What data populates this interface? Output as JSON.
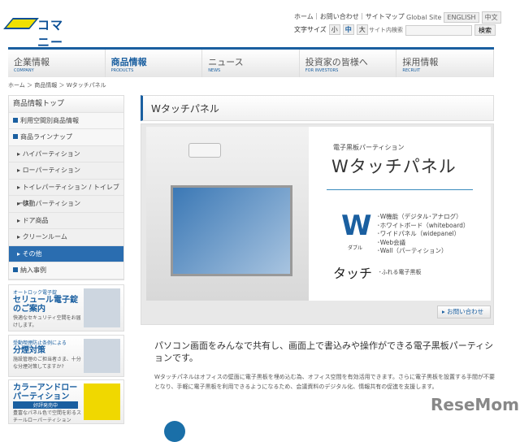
{
  "header": {
    "logo_text": "コマニー",
    "top_links": "ホーム｜お問い合わせ｜サイトマップ",
    "global_label": "Global Site",
    "english": "ENGLISH",
    "chinese": "中文",
    "font_size_label": "文字サイズ",
    "sizes": [
      "小",
      "中",
      "大"
    ],
    "search_label": "サイト内検索",
    "search_value": "",
    "search_button": "検索"
  },
  "nav": [
    {
      "ja": "企業情報",
      "en": "COMPANY"
    },
    {
      "ja": "商品情報",
      "en": "PRODUCTS"
    },
    {
      "ja": "ニュース",
      "en": "NEWS"
    },
    {
      "ja": "投資家の皆様へ",
      "en": "FOR INVESTORS"
    },
    {
      "ja": "採用情報",
      "en": "RECRUIT"
    }
  ],
  "breadcrumb": "ホーム ＞ 商品情報 ＞ Wタッチパネル",
  "sidebar": {
    "top": "商品情報トップ",
    "items": [
      "利用空間別商品情報",
      "商品ラインナップ",
      "ハイパーティション",
      "ローパーティション",
      "トイレパーティション / トイレブース",
      "移動パーティション",
      "ドア商品",
      "クリーンルーム",
      "その他",
      "納入事例"
    ]
  },
  "banners": [
    {
      "s1": "オートロック電子錠",
      "s2": "セリュール電子錠のご案内",
      "s3": "快適なセキュリティ空間をお届けします。"
    },
    {
      "s1": "受動喫煙防止条例による",
      "s2": "分煙対策",
      "s3": "施設管理のご担当者さま、十分な分煙対策してますか?"
    },
    {
      "s1": "",
      "s2": "カラーアンドローパーティション",
      "badge": "好評発売中",
      "s3": "豊富なパネル色で空間を彩るスチールローパーティション"
    }
  ],
  "main": {
    "title": "Wタッチパネル",
    "kicker": "電子黒板パーティション",
    "product": "Wタッチパネル",
    "w_letter": "W",
    "w_caption": "ダブル",
    "features": [
      "･W機能（デジタル･アナログ）",
      "･ホワイトボード（whiteboard）",
      "･ワイドパネル（widepanel）",
      "･Web会議",
      "･Wall（パーティション）"
    ],
    "touch": "タッチ",
    "touch_desc": "･ふれる電子黒板",
    "contact": "お問い合わせ",
    "lead": "パソコン画面をみんなで共有し、画面上で書込みや操作ができる電子黒板パーティションです。",
    "body": "Wタッチパネルはオフィスの壁面に電子黒板を埋め込む為、オフィス空間を有効活用できます。さらに電子黒板を設置する手間が不要となり、手軽に電子黒板を利用できるようになるため、会議資料のデジタル化、情報共有の促進を支援します。"
  },
  "watermark": "ReseMom"
}
